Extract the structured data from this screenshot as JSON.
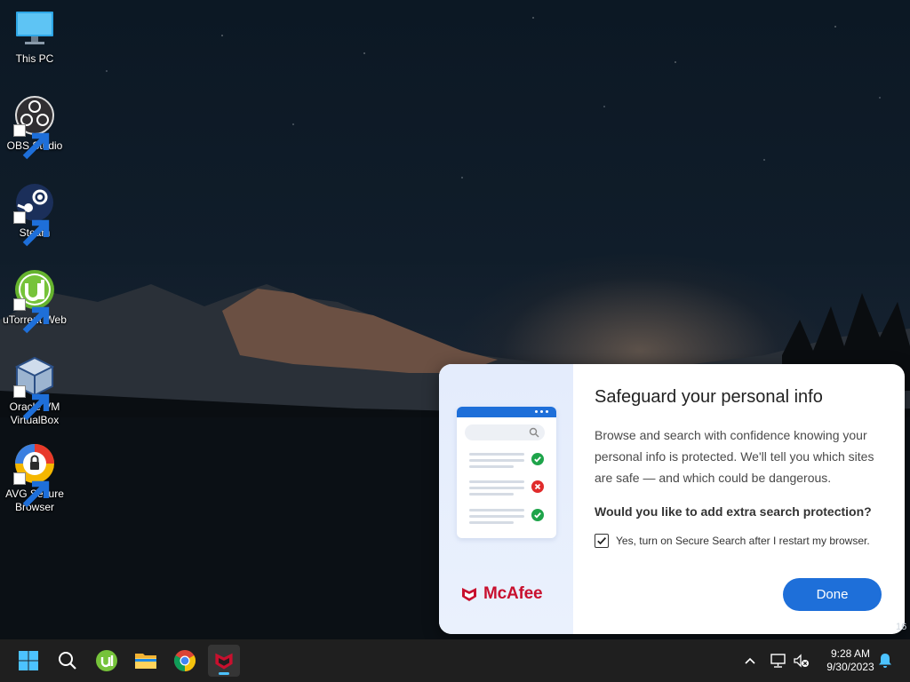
{
  "desktop": {
    "icons": [
      {
        "label": "This PC",
        "icon": "computer-icon"
      },
      {
        "label": "OBS Studio",
        "icon": "obs-icon"
      },
      {
        "label": "Steam",
        "icon": "steam-icon"
      },
      {
        "label": "uTorrent Web",
        "icon": "utorrent-icon"
      },
      {
        "label": "Oracle VM VirtualBox",
        "icon": "virtualbox-icon"
      },
      {
        "label": "AVG Secure Browser",
        "icon": "avg-browser-icon"
      }
    ]
  },
  "popup": {
    "title": "Safeguard your personal info",
    "body": "Browse and search with confidence knowing your personal info is protected. We'll tell you which sites are safe — and which could be dangerous.",
    "question": "Would you like to add extra search protection?",
    "checkbox_label": "Yes, turn on Secure Search after I restart my browser.",
    "checkbox_checked": true,
    "done_label": "Done",
    "brand": "McAfee",
    "colors": {
      "accent": "#1e6fd9",
      "brand": "#c8102e"
    }
  },
  "stray_text": "16",
  "taskbar": {
    "items": [
      {
        "icon": "windows-start-icon"
      },
      {
        "icon": "search-icon"
      },
      {
        "icon": "utorrent-icon"
      },
      {
        "icon": "file-explorer-icon"
      },
      {
        "icon": "chrome-icon"
      },
      {
        "icon": "mcafee-icon",
        "active": true
      }
    ],
    "tray": [
      {
        "icon": "chevron-up-icon"
      },
      {
        "icon": "network-icon"
      },
      {
        "icon": "volume-muted-icon"
      }
    ],
    "clock": {
      "time": "9:28 AM",
      "date": "9/30/2023"
    },
    "notification_icon": "bell-icon"
  }
}
